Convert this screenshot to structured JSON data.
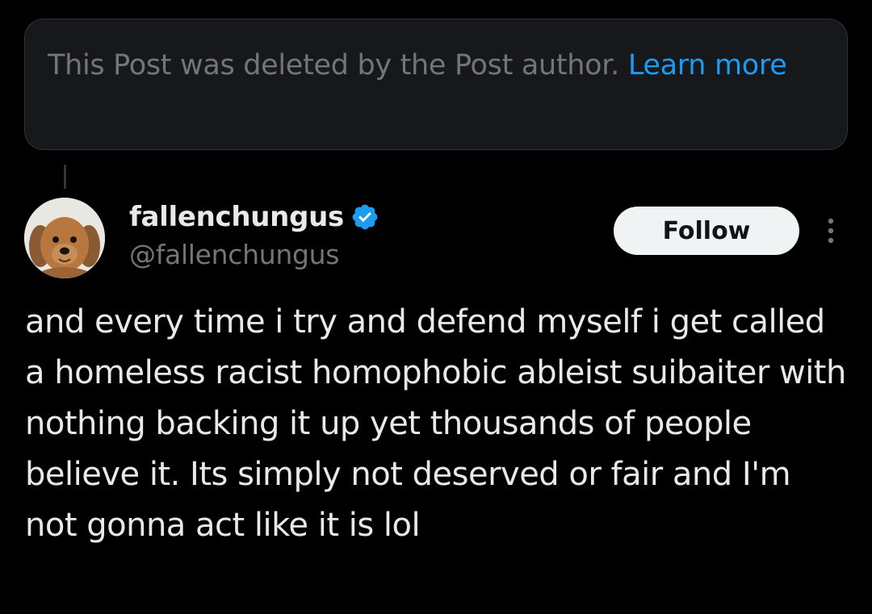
{
  "notice": {
    "text": "This Post was deleted by the Post author.",
    "link_label": "Learn more"
  },
  "author": {
    "display_name": "fallenchungus",
    "handle": "@fallenchungus",
    "verified": true
  },
  "follow_button": {
    "label": "Follow"
  },
  "more_icon": "more-vertical-icon",
  "post": {
    "text": "and every time i try and defend myself i get called a homeless racist homophobic ableist suibaiter with nothing backing it up yet thousands of people believe it. Its simply not deserved or fair and I'm not gonna act like it is lol"
  },
  "colors": {
    "background": "#000000",
    "notice_background": "#16181c",
    "link": "#1d9bf0",
    "verified_badge": "#1d9bf0",
    "secondary_text": "#71767b",
    "primary_text": "#e7e9ea",
    "follow_button_bg": "#eff3f4"
  }
}
